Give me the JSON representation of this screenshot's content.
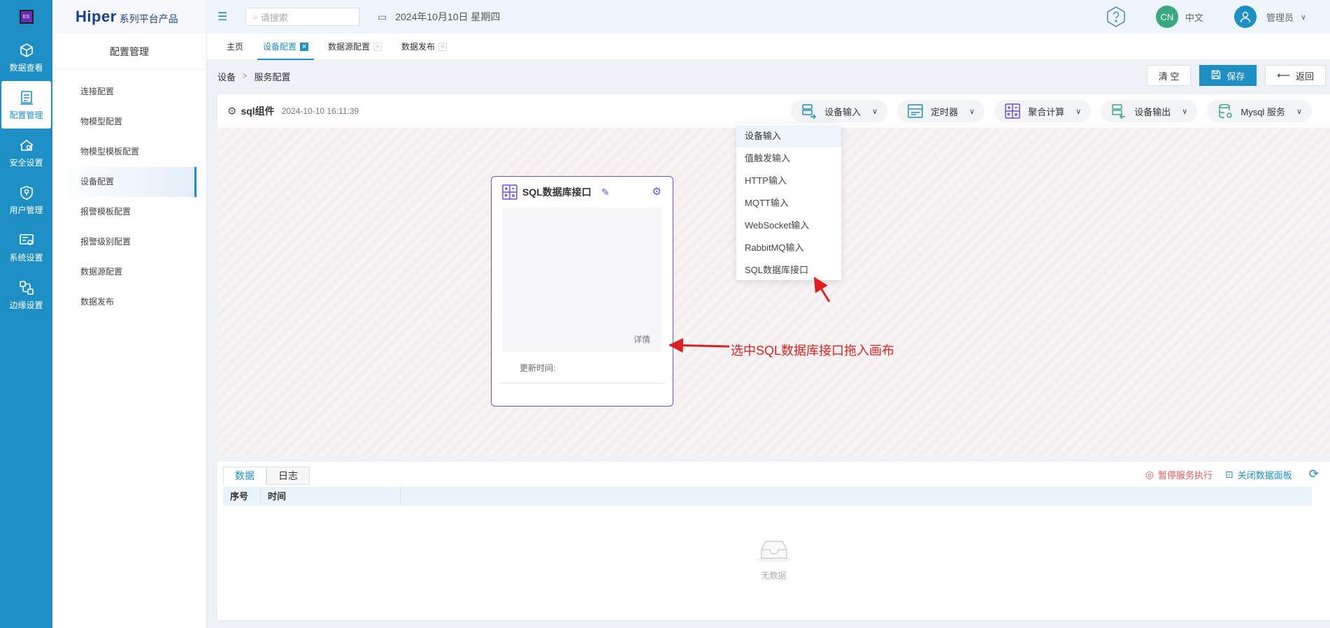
{
  "rail": {
    "logo_text": "ES",
    "items": [
      {
        "label": "数据查看",
        "icon": "cube-icon"
      },
      {
        "label": "配置管理",
        "icon": "config-icon"
      },
      {
        "label": "安全设置",
        "icon": "security-icon"
      },
      {
        "label": "用户管理",
        "icon": "shield-user-icon"
      },
      {
        "label": "系统设置",
        "icon": "system-settings-icon"
      },
      {
        "label": "边缘设置",
        "icon": "edge-icon"
      }
    ],
    "active_index": 1
  },
  "brand": {
    "name": "Hiper",
    "subtitle": "系列平台产品"
  },
  "sidebar": {
    "title": "配置管理",
    "items": [
      {
        "label": "连接配置"
      },
      {
        "label": "物模型配置"
      },
      {
        "label": "物模型模板配置"
      },
      {
        "label": "设备配置"
      },
      {
        "label": "报警模板配置"
      },
      {
        "label": "报警级别配置"
      },
      {
        "label": "数据源配置"
      },
      {
        "label": "数据发布"
      }
    ],
    "active_index": 3
  },
  "header": {
    "search_placeholder": "请搜索",
    "date": "2024年10月10日 星期四",
    "lang_avatar": "CN",
    "lang_label": "中文",
    "user_name": "管理员"
  },
  "tabs": [
    {
      "label": "主页",
      "closable": false
    },
    {
      "label": "设备配置",
      "closable": true,
      "active": true
    },
    {
      "label": "数据源配置",
      "closable": true
    },
    {
      "label": "数据发布",
      "closable": true
    }
  ],
  "breadcrumb": {
    "root": "设备",
    "current": "服务配置"
  },
  "actions": {
    "clear": "清 空",
    "save": "保存",
    "back": "返回"
  },
  "panel": {
    "title": "sql组件",
    "timestamp": "2024-10-10 16:11:39",
    "groups": [
      {
        "label": "设备输入",
        "icon": "device-input-icon"
      },
      {
        "label": "定时器",
        "icon": "timer-icon"
      },
      {
        "label": "聚合计算",
        "icon": "calc-icon"
      },
      {
        "label": "设备输出",
        "icon": "device-output-icon"
      },
      {
        "label": "Mysql 服务",
        "icon": "database-icon"
      }
    ]
  },
  "dropdown": {
    "items": [
      "设备输入",
      "值触发输入",
      "HTTP输入",
      "MQTT输入",
      "WebSocket输入",
      "RabbitMQ输入",
      "SQL数据库接口"
    ],
    "selected_index": 0
  },
  "node": {
    "title": "SQL数据库接口",
    "detail": "详情",
    "update_label": "更新时间:"
  },
  "annotation": {
    "text": "选中SQL数据库接口拖入画布",
    "color": "#e02020"
  },
  "data_panel": {
    "tabs": [
      "数据",
      "日志"
    ],
    "active_tab": 0,
    "pause_label": "暂停服务执行",
    "close_label": "关闭数据面板",
    "columns": [
      "序号",
      "时间"
    ],
    "empty_text": "无数据"
  },
  "colors": {
    "accent": "#1d8fc4",
    "node_border": "#6c4ed8",
    "danger": "#e25656"
  }
}
